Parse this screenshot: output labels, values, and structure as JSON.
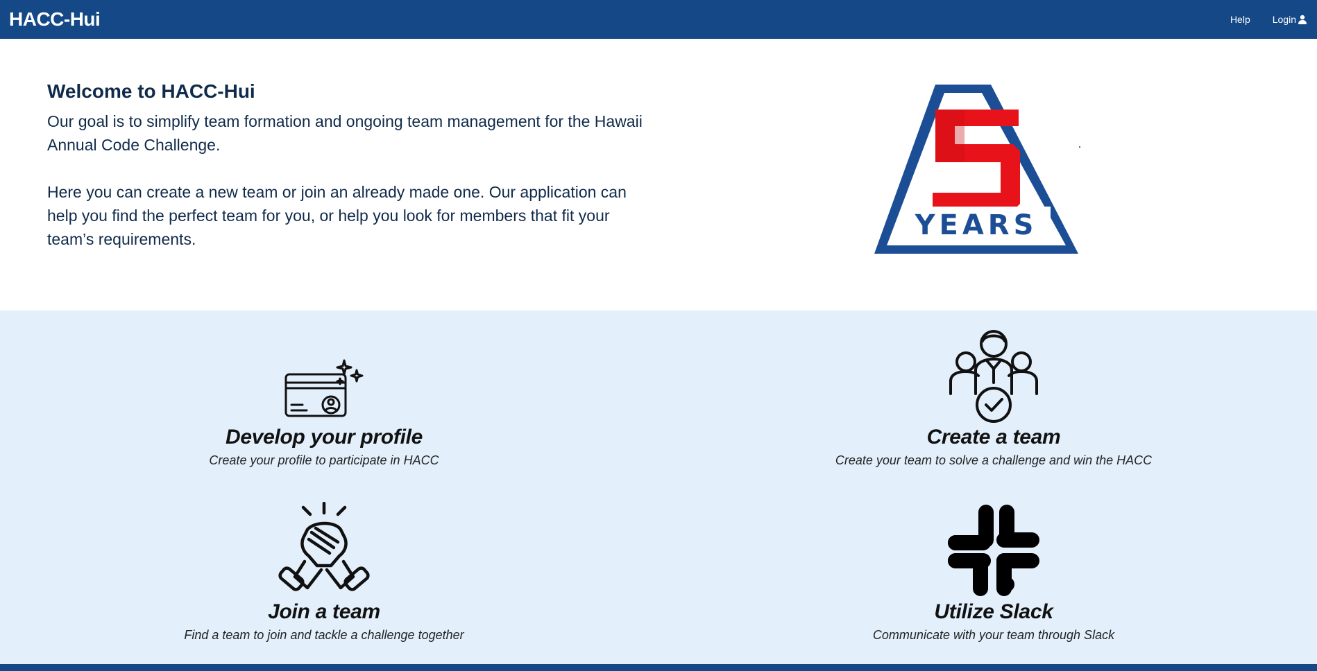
{
  "navbar": {
    "brand": "HACC-Hui",
    "help_label": "Help",
    "login_label": "Login",
    "login_icon": "user-icon",
    "bg_color": "#154886"
  },
  "hero": {
    "title": "Welcome to HACC-Hui",
    "paragraph1": "Our goal is to simplify team formation and ongoing team management for the Hawaii Annual Code Challenge.",
    "paragraph2": "Here you can create a new team or join an already made one. Our application can help you find the perfect team for you, or help you look for members that fit your team’s requirements.",
    "logo": {
      "digit": "5",
      "text": "YEARS",
      "digit_color": "#e8121a",
      "frame_color": "#1c4e96"
    }
  },
  "features": {
    "bg_color": "#e3effb",
    "items": [
      {
        "icon": "profile-card-icon",
        "title": "Develop your profile",
        "description": "Create your profile to participate in HACC"
      },
      {
        "icon": "team-leader-icon",
        "title": "Create a team",
        "description": "Create your team to solve a challenge and win the HACC"
      },
      {
        "icon": "handshake-icon",
        "title": "Join a team",
        "description": "Find a team to join and tackle a challenge together"
      },
      {
        "icon": "slack-icon",
        "title": "Utilize Slack",
        "description": "Communicate with your team through Slack"
      }
    ]
  }
}
